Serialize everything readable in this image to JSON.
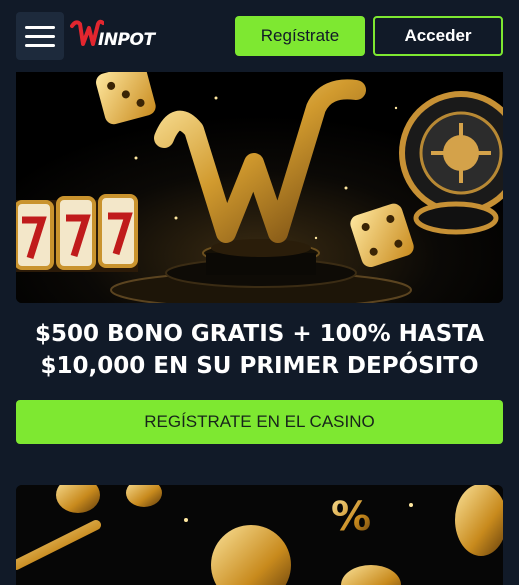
{
  "header": {
    "logo_text": "INPOT",
    "register_label": "Regístrate",
    "login_label": "Acceder"
  },
  "promo": {
    "headline_line1": "$500 BONO GRATIS + 100% HASTA",
    "headline_line2": "$10,000 EN SU PRIMER DEPÓSITO",
    "cta_label": "REGÍSTRATE EN EL CASINO"
  },
  "colors": {
    "background": "#111a28",
    "accent": "#7ee831",
    "menu_bg": "#1d2a3c",
    "logo_red": "#e3262f"
  },
  "icons": {
    "menu": "hamburger-icon"
  }
}
